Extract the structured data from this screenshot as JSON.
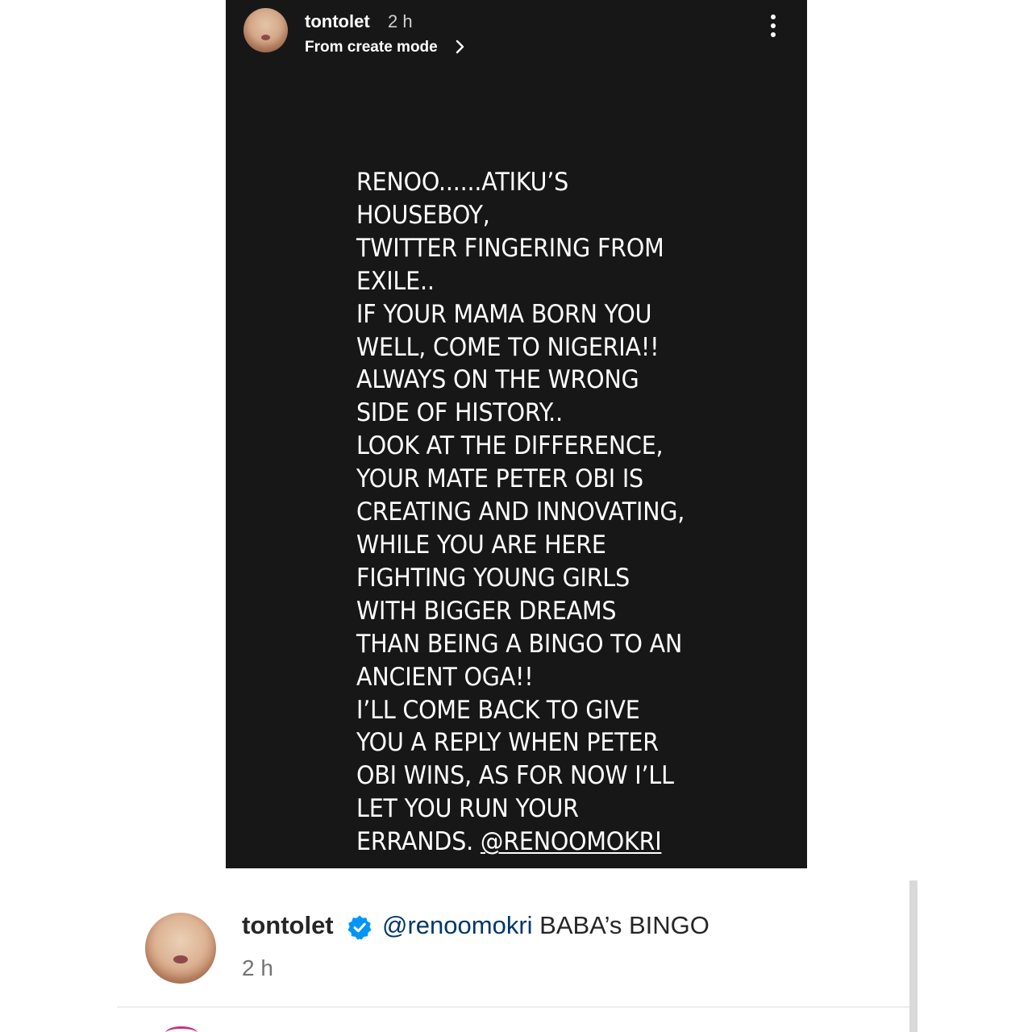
{
  "story": {
    "username": "tontolet",
    "time": "2 h",
    "subtitle": "From create mode",
    "lines": [
      "RENOO......ATIKU’S",
      "HOUSEBOY,",
      "TWITTER FINGERING FROM",
      "EXILE..",
      "IF YOUR MAMA BORN YOU",
      "WELL, COME TO NIGERIA!!",
      "ALWAYS ON THE WRONG",
      "SIDE OF HISTORY..",
      "LOOK AT THE DIFFERENCE,",
      "YOUR MATE PETER OBI IS",
      "CREATING AND INNOVATING,",
      "WHILE YOU ARE HERE",
      "FIGHTING YOUNG GIRLS",
      "WITH BIGGER DREAMS",
      "THAN BEING A BINGO TO AN",
      "ANCIENT OGA!!",
      "I’LL COME BACK TO GIVE",
      "YOU A REPLY WHEN PETER",
      "OBI WINS, AS FOR NOW I’LL",
      "LET YOU RUN YOUR"
    ],
    "last_line_prefix": "ERRANDS.",
    "mention": "@RENOOMOKRI",
    "background_color": "#171717",
    "more_icon": "more-vertical-icon",
    "chevron_icon": "chevron-right-icon"
  },
  "comment": {
    "username": "tontolet",
    "verified_icon": "verified-badge-icon",
    "mention": "@renoomokri",
    "text": "BABA’s BINGO",
    "time": "2 h",
    "mention_color": "#00376b",
    "verified_color": "#0095f6"
  }
}
